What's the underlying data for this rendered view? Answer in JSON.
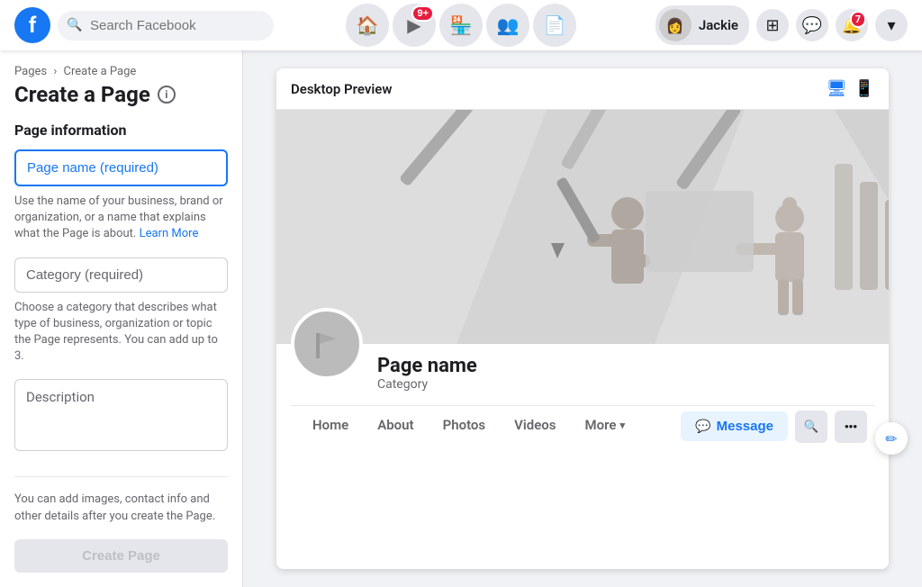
{
  "topnav": {
    "search_placeholder": "Search Facebook",
    "user_name": "Jackie",
    "notification_badge": "7",
    "video_badge": "9+"
  },
  "breadcrumb": {
    "pages_label": "Pages",
    "separator": "›",
    "current": "Create a Page"
  },
  "sidebar": {
    "page_heading": "Create a Page",
    "page_information_label": "Page information",
    "page_name_placeholder": "Page name (required)",
    "page_name_help": "Use the name of your business, brand or organization, or a name that explains what the Page is about.",
    "learn_label": "Learn",
    "more_label": "More",
    "category_placeholder": "Category (required)",
    "category_help": "Choose a category that describes what type of business, organization or topic the Page represents. You can add up to 3.",
    "description_placeholder": "Description",
    "add_details_text": "You can add images, contact info and other details after you create the Page.",
    "create_page_label": "Create Page"
  },
  "preview": {
    "title": "Desktop Preview",
    "desktop_icon": "🖥",
    "mobile_icon": "📱",
    "page_name_display": "Page name",
    "page_category_display": "Category",
    "tabs": [
      {
        "label": "Home",
        "active": false
      },
      {
        "label": "About",
        "active": false
      },
      {
        "label": "Photos",
        "active": false
      },
      {
        "label": "Videos",
        "active": false
      },
      {
        "label": "More",
        "active": false,
        "has_dropdown": true
      }
    ],
    "message_label": "Message",
    "search_icon_label": "🔍",
    "more_actions_label": "•••"
  }
}
